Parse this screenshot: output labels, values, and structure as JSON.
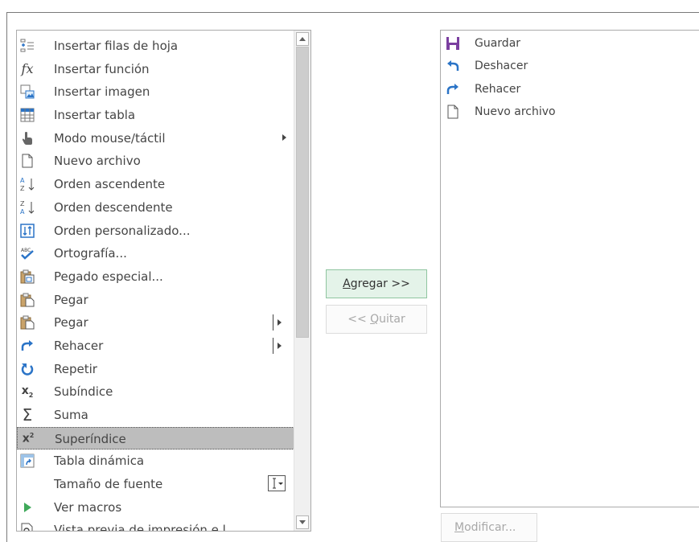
{
  "left_list": {
    "items": [
      {
        "label": "Insertar filas de hoja",
        "icon": "insert-rows-icon"
      },
      {
        "label": "Insertar función",
        "icon": "function-icon"
      },
      {
        "label": "Insertar imagen",
        "icon": "insert-image-icon"
      },
      {
        "label": "Insertar tabla",
        "icon": "insert-table-icon"
      },
      {
        "label": "Modo mouse/táctil",
        "icon": "touch-mode-icon",
        "submenu": true
      },
      {
        "label": "Nuevo archivo",
        "icon": "new-file-icon"
      },
      {
        "label": "Orden ascendente",
        "icon": "sort-ascending-icon"
      },
      {
        "label": "Orden descendente",
        "icon": "sort-descending-icon"
      },
      {
        "label": "Orden personalizado...",
        "icon": "custom-sort-icon"
      },
      {
        "label": "Ortografía...",
        "icon": "spelling-icon"
      },
      {
        "label": "Pegado especial...",
        "icon": "paste-special-icon"
      },
      {
        "label": "Pegar",
        "icon": "paste-icon"
      },
      {
        "label": "Pegar",
        "icon": "paste-icon",
        "split": true
      },
      {
        "label": "Rehacer",
        "icon": "redo-icon",
        "split": true
      },
      {
        "label": "Repetir",
        "icon": "repeat-icon"
      },
      {
        "label": "Subíndice",
        "icon": "subscript-icon"
      },
      {
        "label": "Suma",
        "icon": "sum-icon"
      },
      {
        "label": "Superíndice",
        "icon": "superscript-icon",
        "selected": true
      },
      {
        "label": "Tabla dinámica",
        "icon": "pivot-table-icon"
      },
      {
        "label": "Tamaño de fuente",
        "icon": "font-size-icon",
        "size_box": true
      },
      {
        "label": "Ver macros",
        "icon": "macro-play-icon"
      },
      {
        "label": "Vista previa de impresión e l...",
        "icon": "print-preview-icon"
      }
    ]
  },
  "buttons": {
    "add_label": "Agregar >>",
    "remove_label": "<< Quitar",
    "modify_label": "Modificar..."
  },
  "right_list": {
    "items": [
      {
        "label": "Guardar",
        "icon": "save-icon"
      },
      {
        "label": "Deshacer",
        "icon": "undo-icon"
      },
      {
        "label": "Rehacer",
        "icon": "redo-icon"
      },
      {
        "label": "Nuevo archivo",
        "icon": "new-file-icon"
      }
    ]
  },
  "colors": {
    "accent_blue": "#2b74c7",
    "save_purple": "#7b3fa0",
    "add_button_bg": "#e4f3e9",
    "selected_bg": "#bdbdbd"
  }
}
